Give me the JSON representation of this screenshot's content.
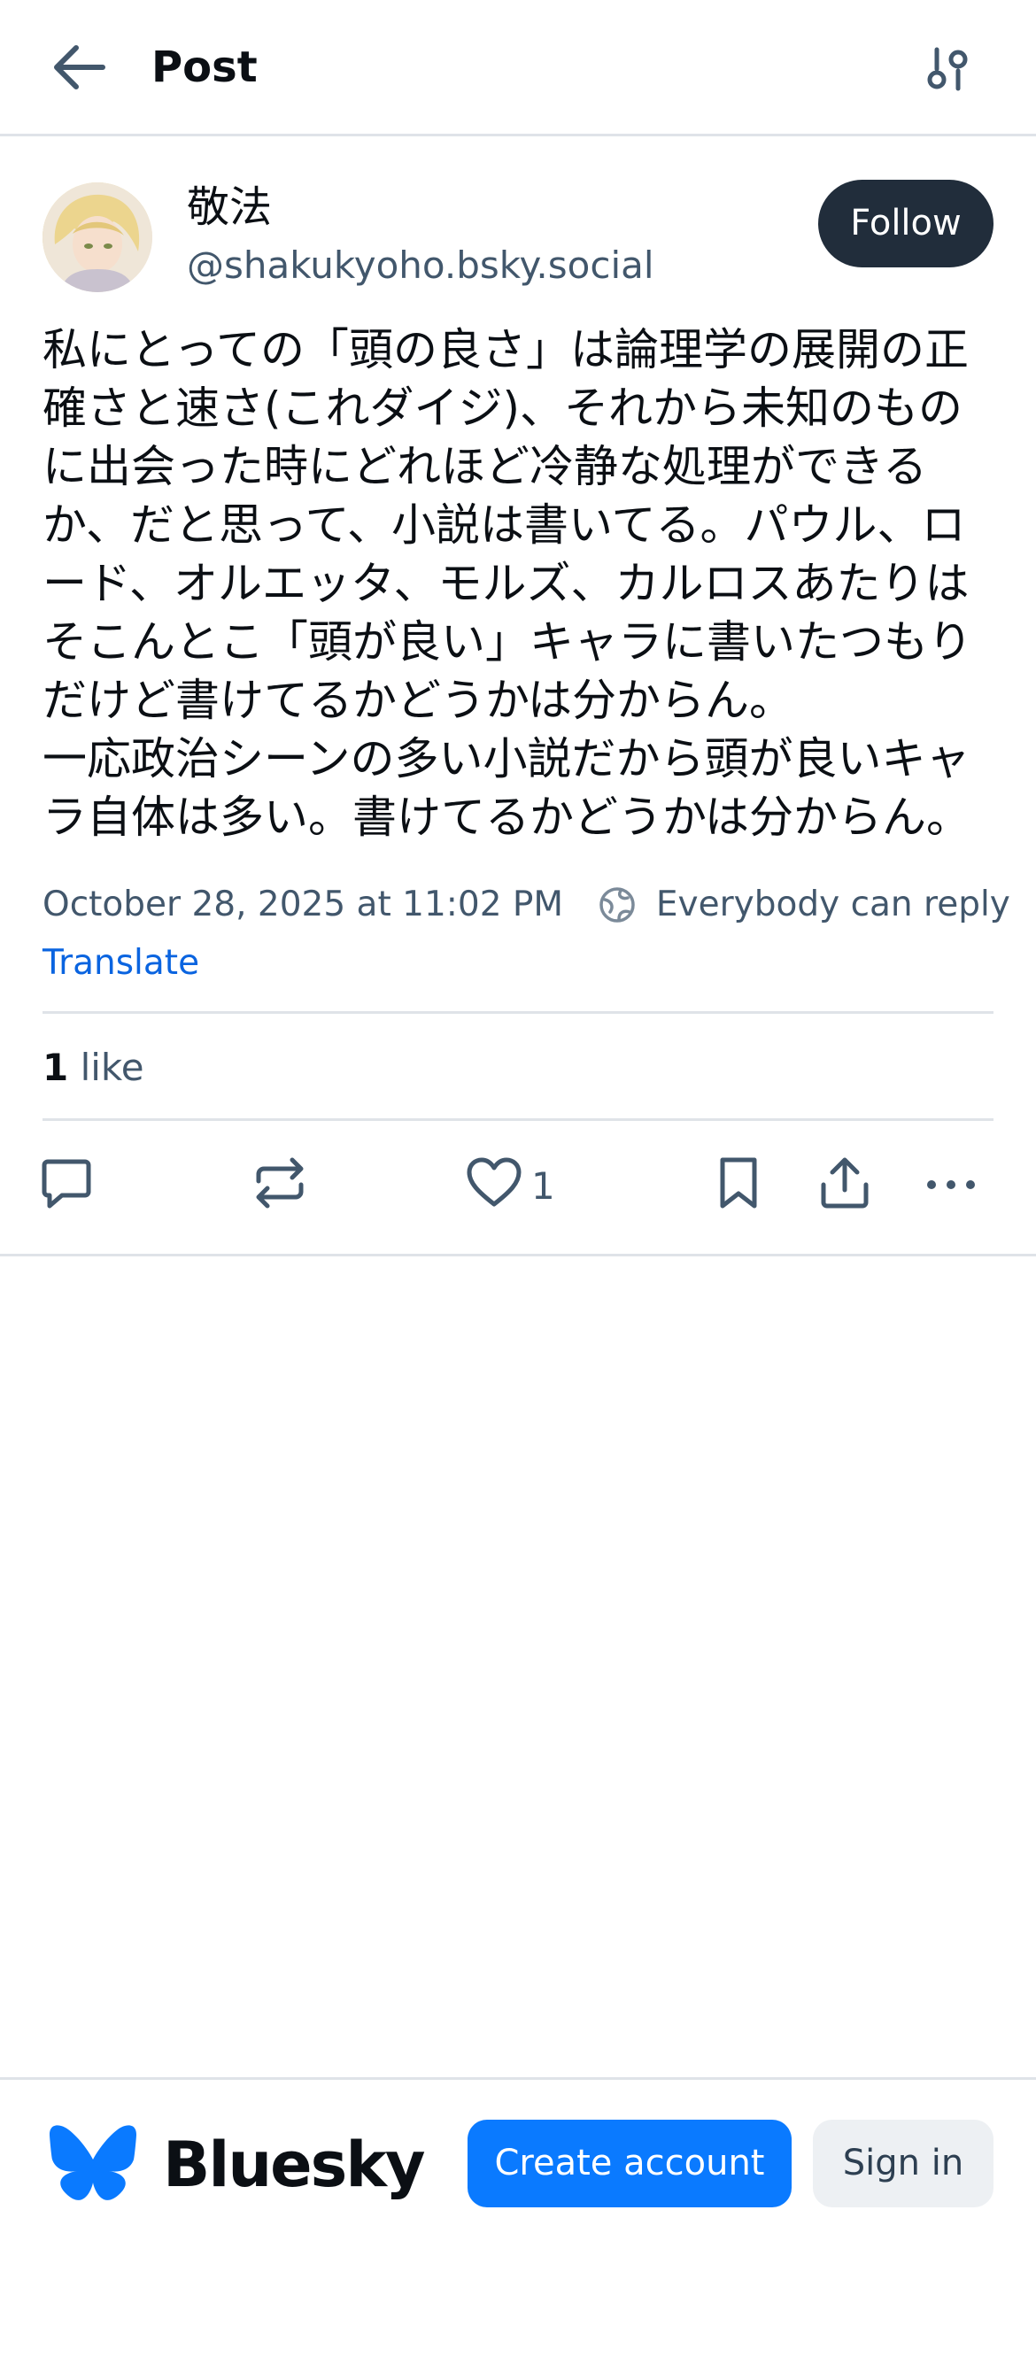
{
  "header": {
    "title": "Post"
  },
  "author": {
    "display_name": "敬法",
    "handle": "@shakukyoho.bsky.social",
    "follow_label": "Follow"
  },
  "post": {
    "text": "私にとっての「頭の良さ」は論理学の展開の正\n確さと速さ(これダイジ)、それから未知のもの\nに出会った時にどれほど冷静な処理ができる\nか、だと思って、小説は書いてる。パウル、ロ\nード、オルエッタ、モルズ、カルロスあたりは\nそこんとこ「頭が良い」キャラに書いたつもり\nだけど書けてるかどうかは分からん。\n一応政治シーンの多い小説だから頭が良いキャ\nラ自体は多い。書けてるかどうかは分からん。",
    "timestamp": "October 28, 2025 at 11:02 PM",
    "reply_setting": "Everybody can reply",
    "separator": "·",
    "translate_label": "Translate",
    "like_count": "1",
    "like_word": "like",
    "action_like_count": "1"
  },
  "footer": {
    "brand": "Bluesky",
    "create_account_label": "Create account",
    "sign_in_label": "Sign in"
  },
  "colors": {
    "brand_blue": "#0a7aff",
    "follow_bg": "#212d3b",
    "muted_text": "#42576c",
    "link": "#0a64e0"
  }
}
